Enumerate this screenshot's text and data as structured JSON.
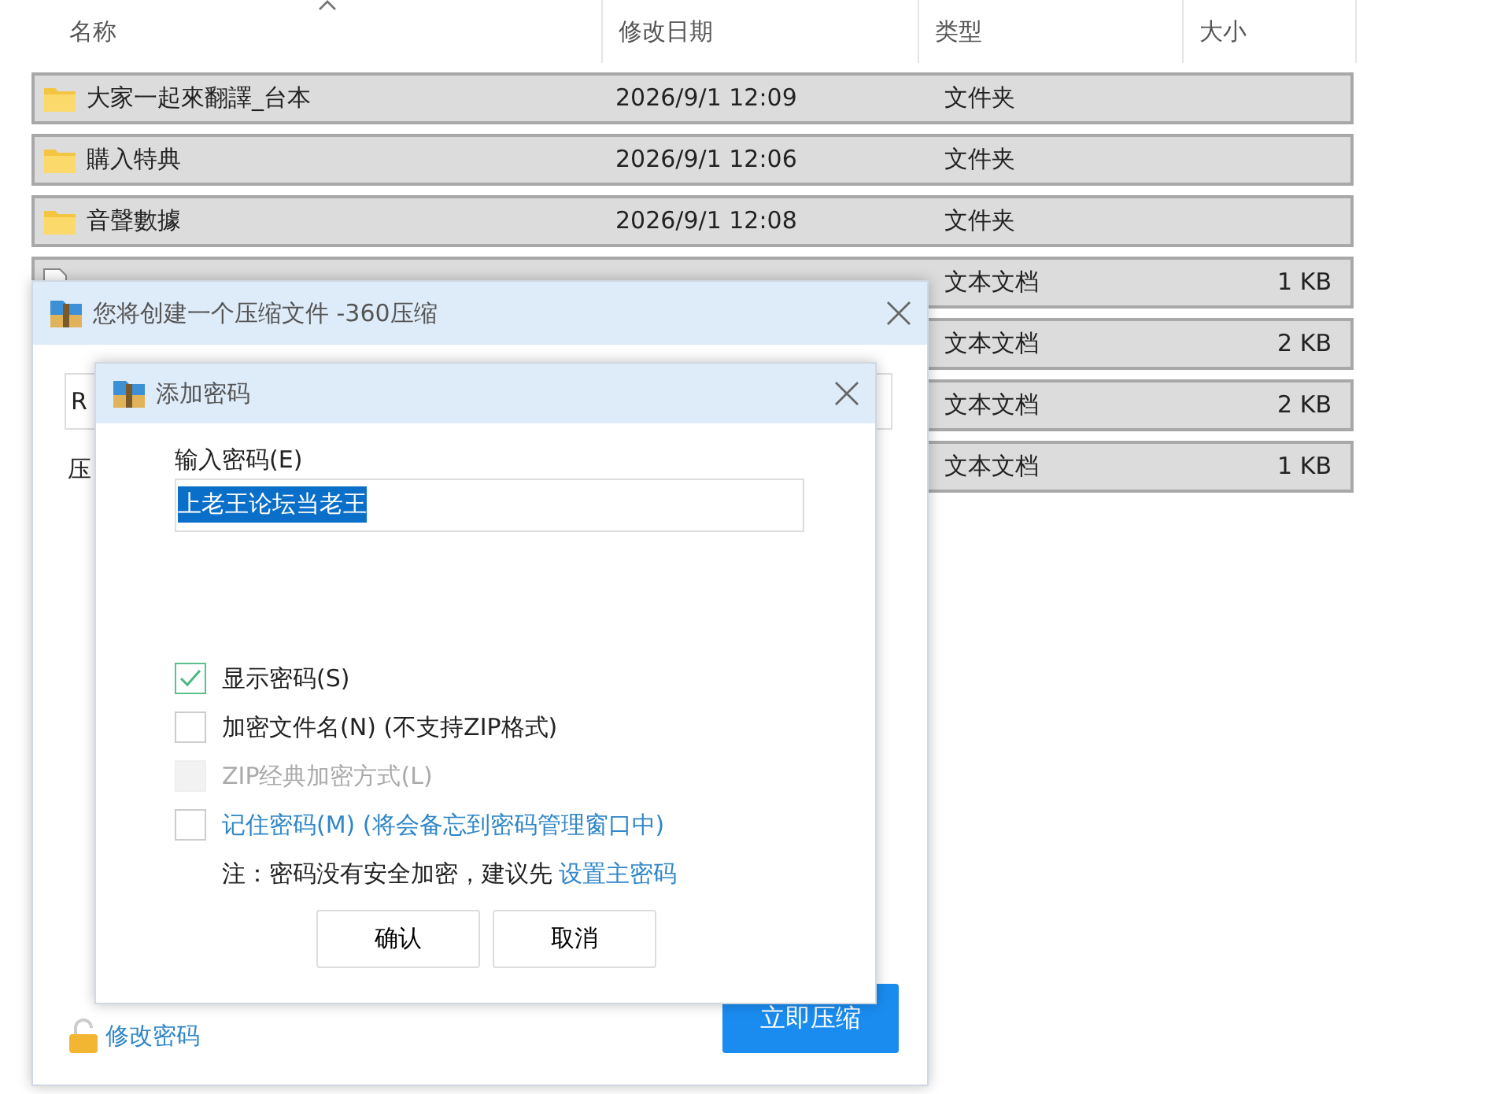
{
  "explorer": {
    "columns": [
      "名称",
      "修改日期",
      "类型",
      "大小"
    ],
    "rows": [
      {
        "kind": "folder",
        "name": "大家一起來翻譯_台本",
        "date": "2026/9/1 12:09",
        "type": "文件夹",
        "selected": true
      },
      {
        "kind": "folder",
        "name": "購入特典",
        "date": "2026/9/1 12:06",
        "type": "文件夹",
        "selected": true
      },
      {
        "kind": "folder",
        "name": "音聲數據",
        "date": "2026/9/1 12:08",
        "type": "文件夹",
        "selected": true
      },
      {
        "kind": "file",
        "type": "文本文档",
        "size": "1 KB",
        "selected": true
      },
      {
        "type": "文本文档",
        "size": "2 KB",
        "selected": true
      },
      {
        "type": "文本文档",
        "size": "2 KB",
        "selected": true
      },
      {
        "type": "文本文档",
        "size": "1 KB",
        "selected": true
      }
    ]
  },
  "create_dialog": {
    "title": "您将创建一个压缩文件 -360压缩",
    "field_value": "R",
    "label": "压",
    "change_password": "修改密码",
    "compress_button": "立即压缩"
  },
  "password_dialog": {
    "title": "添加密码",
    "password_label": "输入密码(E)",
    "password_value": "上老王论坛当老王",
    "options": [
      {
        "kind": "plain",
        "label": "显示密码(S)",
        "checked": true,
        "disabled": false
      },
      {
        "kind": "plain",
        "label": "加密文件名(N) (不支持ZIP格式)",
        "checked": false,
        "disabled": false
      },
      {
        "kind": "plain",
        "label": "ZIP经典加密方式(L)",
        "checked": false,
        "disabled": true
      },
      {
        "kind": "link",
        "label": "记住密码(M) (将会备忘到密码管理窗口中)",
        "checked": false,
        "disabled": false
      }
    ],
    "note": "注：密码没有安全加密，建议先",
    "note_link": "设置主密码",
    "buttons": [
      "确认",
      "取消"
    ]
  }
}
